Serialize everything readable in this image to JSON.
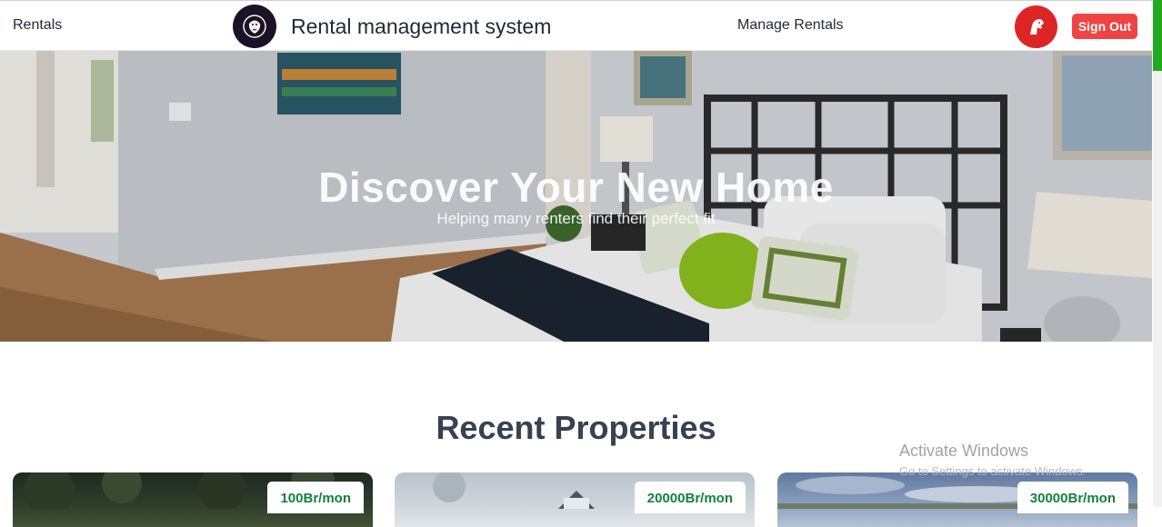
{
  "header": {
    "rentals_label": "Rentals",
    "app_title": "Rental management system",
    "manage_rentals_label": "Manage Rentals",
    "sign_out_label": "Sign Out",
    "logo_icon": "lion-logo-icon",
    "avatar_icon": "horse-avatar-icon"
  },
  "hero": {
    "title": "Discover Your New Home",
    "subtitle": "Helping many renters find their perfect fit"
  },
  "section": {
    "title": "Recent Properties"
  },
  "properties": [
    {
      "price": "100Br/mon"
    },
    {
      "price": "20000Br/mon"
    },
    {
      "price": "30000Br/mon"
    }
  ],
  "watermark": {
    "line1": "Activate Windows",
    "line2": "Go to Settings to activate Windows."
  },
  "colors": {
    "accent_red": "#ef4444",
    "price_green": "#15803d",
    "logo_bg": "#1b1226"
  }
}
